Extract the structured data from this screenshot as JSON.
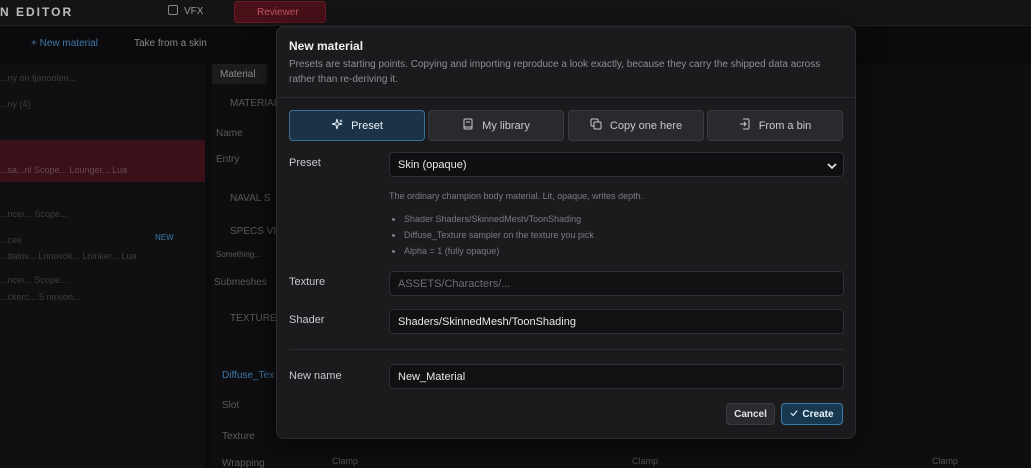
{
  "background": {
    "app_title": "N EDITOR",
    "app_subtitle": "",
    "tab_vfx": "VFX",
    "tab_red": "Reviewer",
    "toolbar": {
      "new_material": "+ New material",
      "take_from_skin": "Take from a skin"
    },
    "sidebar_lines": [
      "...ny on fjanoolen...",
      "...ny (4)",
      "...sa...nl Scope...  Lounger...   Lua",
      "...ncer... Scope...",
      "...cee",
      "...dalov...  Lnnovok...  Loinker...  Lua",
      "...ncer... Scope...",
      "...ckerc... 5 nexion..."
    ],
    "sidebar_new_tag": "NEW",
    "material_tab": "Material",
    "right_labels": [
      "MATERIAL",
      "Name",
      "Entry",
      "NAVAL S",
      "SPECS VI",
      "Something...",
      "Submeshes",
      "TEXTURE",
      "Diffuse_Tex",
      "Slot",
      "Texture",
      "Wrapping"
    ],
    "bottom_labels": [
      "Clamp",
      "Clamp",
      "Clamp"
    ]
  },
  "modal": {
    "title": "New material",
    "description": "Presets are starting points. Copying and importing reproduce a look exactly, because they carry the shipped data across rather than re-deriving it.",
    "tabs": [
      {
        "label": "Preset",
        "icon": "sparkle-icon",
        "active": true
      },
      {
        "label": "My library",
        "icon": "book-icon",
        "active": false
      },
      {
        "label": "Copy one here",
        "icon": "copy-icon",
        "active": false
      },
      {
        "label": "From a bin",
        "icon": "import-icon",
        "active": false
      }
    ],
    "preset": {
      "label": "Preset",
      "selected": "Skin (opaque)",
      "description": "The ordinary champion body material. Lit, opaque, writes depth.",
      "bullets": [
        "Shader Shaders/SkinnedMesh/ToonShading",
        "Diffuse_Texture sampler on the texture you pick",
        "Alpha = 1 (fully opaque)"
      ]
    },
    "texture": {
      "label": "Texture",
      "placeholder": "ASSETS/Characters/..."
    },
    "shader": {
      "label": "Shader",
      "value": "Shaders/SkinnedMesh/ToonShading"
    },
    "new_name": {
      "label": "New name",
      "value": "New_Material"
    },
    "buttons": {
      "cancel": "Cancel",
      "create": "Create",
      "create_icon": "check-icon"
    }
  }
}
